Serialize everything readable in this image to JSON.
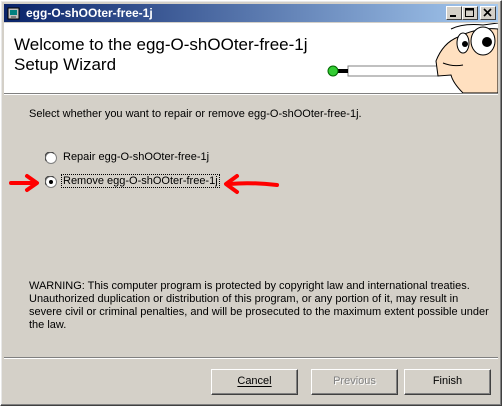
{
  "window": {
    "title": "egg-O-shOOter-free-1j"
  },
  "header": {
    "title_line1": "Welcome to the egg-O-shOOter-free-1j",
    "title_line2": "Setup Wizard"
  },
  "prompt": "Select whether you want to repair or remove egg-O-shOOter-free-1j.",
  "options": [
    {
      "label": "Repair egg-O-shOOter-free-1j",
      "selected": false
    },
    {
      "label": "Remove egg-O-shOOter-free-1j",
      "selected": true
    }
  ],
  "warning": "WARNING: This computer program is protected by copyright law and international treaties. Unauthorized duplication or distribution of this program, or any portion of it, may result in severe civil or criminal penalties, and will be prosecuted to the maximum extent possible under the law.",
  "buttons": {
    "cancel": "Cancel",
    "previous": "Previous",
    "finish": "Finish"
  },
  "colors": {
    "titlebar_start": "#0a246a",
    "titlebar_end": "#a6caf0",
    "dialog_bg": "#d4d0c8",
    "annotation_arrow": "#ff0000"
  }
}
